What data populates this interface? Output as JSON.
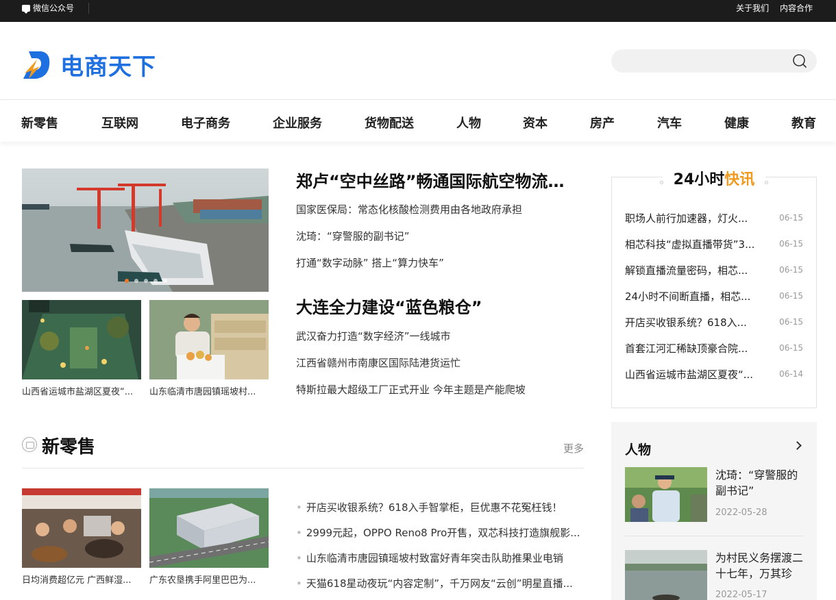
{
  "topbar": {
    "wechat": "微信公众号",
    "about": "关于我们",
    "cooperation": "内容合作"
  },
  "logo": {
    "text": "电商天下"
  },
  "search": {
    "placeholder": ""
  },
  "nav": [
    "新零售",
    "互联网",
    "电子商务",
    "企业服务",
    "货物配送",
    "人物",
    "资本",
    "房产",
    "汽车",
    "健康",
    "教育"
  ],
  "hero": {
    "thumb_captions": [
      "山西省运城市盐湖区夏夜“...",
      "山东临清市唐园镇瑶坡村..."
    ],
    "stories": [
      {
        "headline": "郑卢“空中丝路”畅通国际航空物流大...",
        "subs": [
          "国家医保局：常态化核酸检测费用由各地政府承担",
          "沈琦：“穿警服的副书记”",
          "打通“数字动脉” 搭上“算力快车”"
        ]
      },
      {
        "headline": "大连全力建设“蓝色粮仓”",
        "subs": [
          "武汉奋力打造“数字经济”一线城市",
          "江西省赣州市南康区国际陆港货运忙",
          "特斯拉最大超级工厂正式开业 今年主题是产能爬坡"
        ]
      }
    ]
  },
  "flash": {
    "title_a": "24小时",
    "title_b": "快讯",
    "items": [
      {
        "t": "职场人前行加速器，灯火...",
        "d": "06-15"
      },
      {
        "t": "相芯科技“虚拟直播带货”3...",
        "d": "06-15"
      },
      {
        "t": "解锁直播流量密码，相芯...",
        "d": "06-15"
      },
      {
        "t": "24小时不间断直播，相芯...",
        "d": "06-15"
      },
      {
        "t": "开店买收银系统？618入...",
        "d": "06-15"
      },
      {
        "t": "首套江河汇稀缺顶豪合院...",
        "d": "06-15"
      },
      {
        "t": "山西省运城市盐湖区夏夜“...",
        "d": "06-14"
      }
    ]
  },
  "section": {
    "title": "新零售",
    "more": "更多",
    "thumb_captions": [
      "日均消费超亿元 广西鲜湿...",
      "广东农垦携手阿里巴巴为..."
    ],
    "bullets": [
      "开店买收银系统？618入手智掌柜，巨优惠不花冤枉钱！",
      "2999元起，OPPO Reno8 Pro开售，双芯科技打造旗舰影...",
      "山东临清市唐园镇瑶坡村致富好青年突击队助推果业电销",
      "天猫618星动夜玩“内容定制”，千万网友“云创”明星直播..."
    ]
  },
  "people": {
    "title": "人物",
    "cards": [
      {
        "t": "沈琦：“穿警服的副书记”",
        "d": "2022-05-28"
      },
      {
        "t": "为村民义务摆渡二十七年，万其珍",
        "d": "2022-05-17"
      }
    ]
  },
  "colors": {
    "brand": "#1e6fe0",
    "accent": "#f29a1e",
    "topbar": "#1c1c1c"
  }
}
